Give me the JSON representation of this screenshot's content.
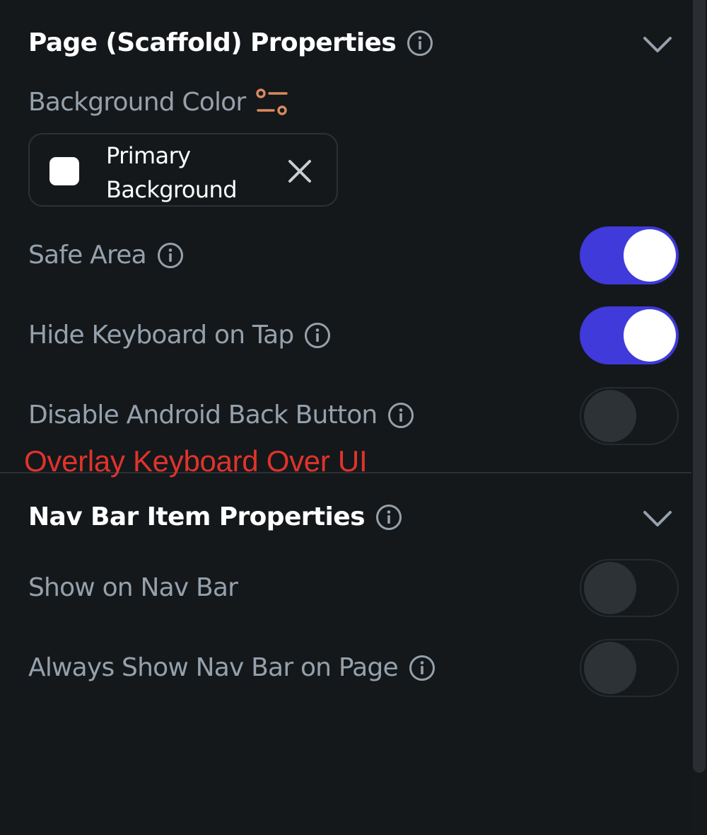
{
  "scaffold_section": {
    "title": "Page (Scaffold) Properties",
    "background_color": {
      "label": "Background Color",
      "value": "Primary Background",
      "swatch_color": "#ffffff"
    },
    "toggles": [
      {
        "label": "Safe Area",
        "on": true
      },
      {
        "label": "Hide Keyboard on Tap",
        "on": true
      },
      {
        "label": "Disable Android Back Button",
        "on": false
      }
    ]
  },
  "annotation": {
    "text": "Overlay Keyboard Over UI",
    "color": "#e0332b"
  },
  "nav_bar_section": {
    "title": "Nav Bar Item Properties",
    "toggles": [
      {
        "label": "Show on Nav Bar",
        "on": false
      },
      {
        "label": "Always Show Nav Bar on Page",
        "on": false
      }
    ]
  },
  "colors": {
    "accent": "#3f3ad9",
    "tune_icon": "#d98a5e",
    "background": "#14181b"
  }
}
